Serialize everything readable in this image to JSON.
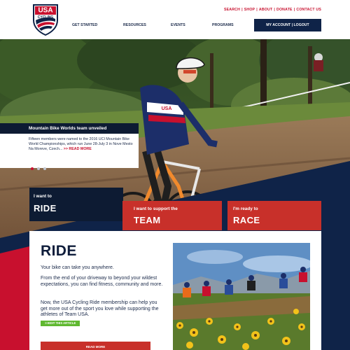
{
  "header": {
    "logo": {
      "line1": "USA",
      "line2": "CYCLING"
    },
    "utility": [
      "SEARCH",
      "SHOP",
      "ABOUT",
      "DONATE",
      "CONTACT US"
    ],
    "nav": [
      "GET STARTED",
      "RESOURCES",
      "EVENTS",
      "PROGRAMS"
    ],
    "account_button": "MY ACCOUNT | LOGOUT"
  },
  "hero": {
    "headline": "Mountain Bike Worlds team unveiled",
    "summary": "Fifteen members were named to the 2016 UCI Mountain Bike World Championships, which run June 28-July 3 in Nove Mesto Na Moreve, Czech...",
    "more_link": ">> READ MORE",
    "slides_total": 3,
    "active_slide": 1,
    "jersey_text": "USA"
  },
  "tiles": {
    "ride": {
      "small": "I want to",
      "big": "RIDE"
    },
    "team": {
      "small": "I want to support the",
      "big": "TEAM"
    },
    "race": {
      "small": "I'm ready to",
      "big": "RACE"
    }
  },
  "content": {
    "heading": "RIDE",
    "p1": "Your bike can take you anywhere.",
    "p2": "From the end of your driveway to beyond your wildest expectations, you can find fitness, community and more.",
    "p3": "Now, the USA Cycling Ride membership can help you get more out of the sport you love while supporting the athletes of Team USA.",
    "edit_button": ">>EDIT THIS ARTICLE",
    "read_more_button": "READ MORE"
  },
  "colors": {
    "navy": "#0f2348",
    "dark_navy": "#0d1b33",
    "red": "#c8302a",
    "brand_red": "#c8102e",
    "green": "#5fb830"
  }
}
